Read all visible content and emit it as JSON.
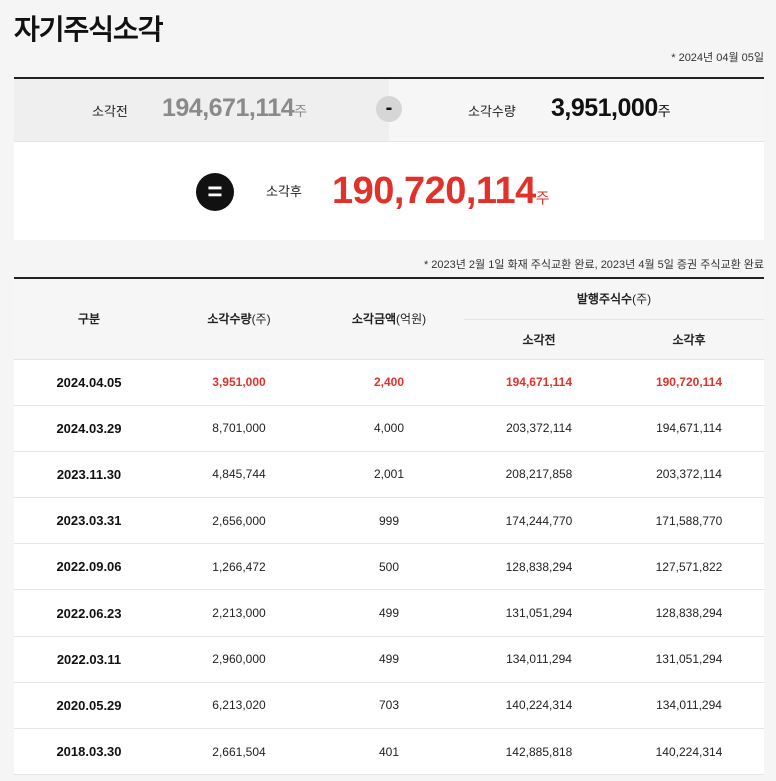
{
  "page": {
    "title": "자기주식소각",
    "as_of": "* 2024년 04월 05일"
  },
  "summary": {
    "before_label": "소각전",
    "before_value": "194,671,114",
    "minus_symbol": "-",
    "qty_label": "소각수량",
    "qty_value": "3,951,000",
    "equals_symbol": "=",
    "after_label": "소각후",
    "after_value": "190,720,114",
    "unit": "주"
  },
  "note": "* 2023년 2월 1일 화재 주식교환 완료, 2023년 4월 5일 증권 주식교환 완료",
  "table": {
    "headers": {
      "category": "구분",
      "qty_main": "소각수량",
      "qty_unit": "(주)",
      "amount_main": "소각금액",
      "amount_unit": "(억원)",
      "issued_main": "발행주식수",
      "issued_unit": "(주)",
      "before": "소각전",
      "after": "소각후"
    },
    "rows": [
      {
        "date": "2024.04.05",
        "qty": "3,951,000",
        "amount": "2,400",
        "before": "194,671,114",
        "after": "190,720,114"
      },
      {
        "date": "2024.03.29",
        "qty": "8,701,000",
        "amount": "4,000",
        "before": "203,372,114",
        "after": "194,671,114"
      },
      {
        "date": "2023.11.30",
        "qty": "4,845,744",
        "amount": "2,001",
        "before": "208,217,858",
        "after": "203,372,114"
      },
      {
        "date": "2023.03.31",
        "qty": "2,656,000",
        "amount": "999",
        "before": "174,244,770",
        "after": "171,588,770"
      },
      {
        "date": "2022.09.06",
        "qty": "1,266,472",
        "amount": "500",
        "before": "128,838,294",
        "after": "127,571,822"
      },
      {
        "date": "2022.06.23",
        "qty": "2,213,000",
        "amount": "499",
        "before": "131,051,294",
        "after": "128,838,294"
      },
      {
        "date": "2022.03.11",
        "qty": "2,960,000",
        "amount": "499",
        "before": "134,011,294",
        "after": "131,051,294"
      },
      {
        "date": "2020.05.29",
        "qty": "6,213,020",
        "amount": "703",
        "before": "140,224,314",
        "after": "134,011,294"
      },
      {
        "date": "2018.03.30",
        "qty": "2,661,504",
        "amount": "401",
        "before": "142,885,818",
        "after": "140,224,314"
      }
    ]
  },
  "colors": {
    "accent_red": "#e0322a",
    "muted_gray": "#888888"
  }
}
